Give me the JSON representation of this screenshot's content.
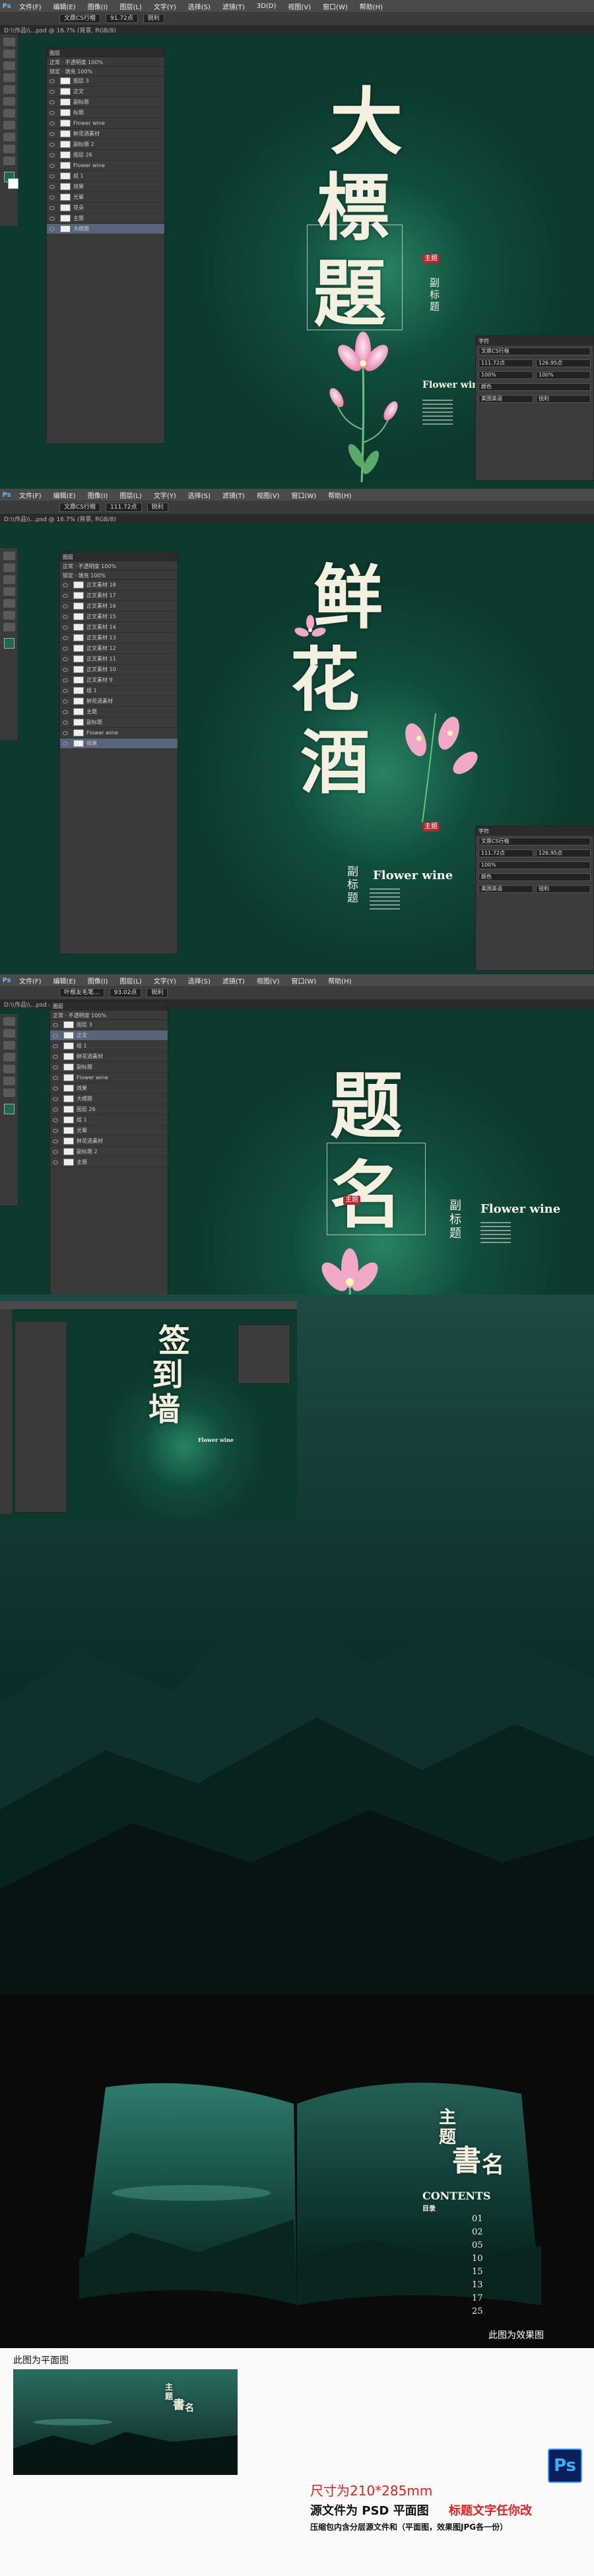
{
  "ps": {
    "logo": "Ps",
    "menu": [
      "文件(F)",
      "编辑(E)",
      "图像(I)",
      "图层(L)",
      "文字(Y)",
      "选择(S)",
      "滤镜(T)",
      "3D(D)",
      "视图(V)",
      "窗口(W)",
      "帮助(H)"
    ],
    "font_field_1": "文鼎CS行楷",
    "font_size_1": "91.72点",
    "font_field_3": "叶根友毛笔...",
    "font_size_3": "93.02点",
    "smooth": "锐利",
    "tab_title": "D:\\\\作品\\\\...psd @ 16.7% (背景, RGB/8)",
    "layer_panel_title": "图层",
    "char_panel_title": "字符",
    "char_font": "文鼎CS行楷",
    "char_size": "111.72点",
    "char_lead": "126.95点",
    "char_scale": "100%",
    "char_color": "颜色",
    "char_lang": "美国英语",
    "char_aa": "锐利"
  },
  "panel1": {
    "title_chars": [
      "大",
      "標",
      "題"
    ],
    "seal": "主题",
    "subtitle": "副标题",
    "english": "Flower wine",
    "layers": [
      "图层 3",
      "正文",
      "副标题",
      "标题",
      "Flower wine",
      "鲜花酒素材",
      "副标题 2",
      "图层 26",
      "Flower wine",
      "组 1",
      "效果",
      "光晕",
      "花朵",
      "主题",
      "大標題"
    ]
  },
  "panel2": {
    "title_chars": [
      "鲜",
      "花",
      "酒"
    ],
    "seal": "主题",
    "subtitle": "副标题",
    "english": "Flower wine",
    "layers": [
      "正文素材 18",
      "正文素材 17",
      "正文素材 16",
      "正文素材 15",
      "正文素材 14",
      "正文素材 13",
      "正文素材 12",
      "正文素材 11",
      "正文素材 10",
      "正文素材 9",
      "组 1",
      "鲜花酒素材",
      "主题",
      "副标题",
      "Flower wine",
      "效果"
    ]
  },
  "panel3": {
    "title_chars": [
      "题",
      "名"
    ],
    "seal": "主题",
    "subtitle": "副标题",
    "english": "Flower wine",
    "layers": [
      "图层 3",
      "正文",
      "组 1",
      "鲜花酒素材",
      "副标题",
      "Flower wine",
      "效果",
      "大標題",
      "图层 26",
      "组 1",
      "光晕",
      "鲜花酒素材",
      "副标题 2",
      "主题"
    ]
  },
  "panel4": {
    "title_chars": [
      "签",
      "到",
      "墙"
    ],
    "english": "Flower wine"
  },
  "mock": {
    "title_lines": [
      "主",
      "题",
      "書",
      "名"
    ],
    "contents": "CONTENTS",
    "contents_cn": "目录",
    "page_numbers": [
      "01",
      "02",
      "05",
      "10",
      "15",
      "13",
      "17",
      "25"
    ],
    "caption": "此图为效果图"
  },
  "flat": {
    "caption": "此图为平面图",
    "size_line": "尺寸为210*285mm",
    "source_line": "源文件为 PSD 平面图",
    "editable_line": "标题文字任你改",
    "package_line": "压缩包内含分层源文件和（平面图，效果图JPG各一份）",
    "ps_badge": "Ps",
    "mini_title": [
      "主",
      "题",
      "書",
      "名"
    ]
  },
  "colors": {
    "background_green": "#0c3a2f",
    "glow_green": "#3cbe8c",
    "title_cream": "#f4f0e0",
    "seal_red": "#b3262b",
    "info_red": "#e02020",
    "ps_blue": "#0a1f5c"
  }
}
